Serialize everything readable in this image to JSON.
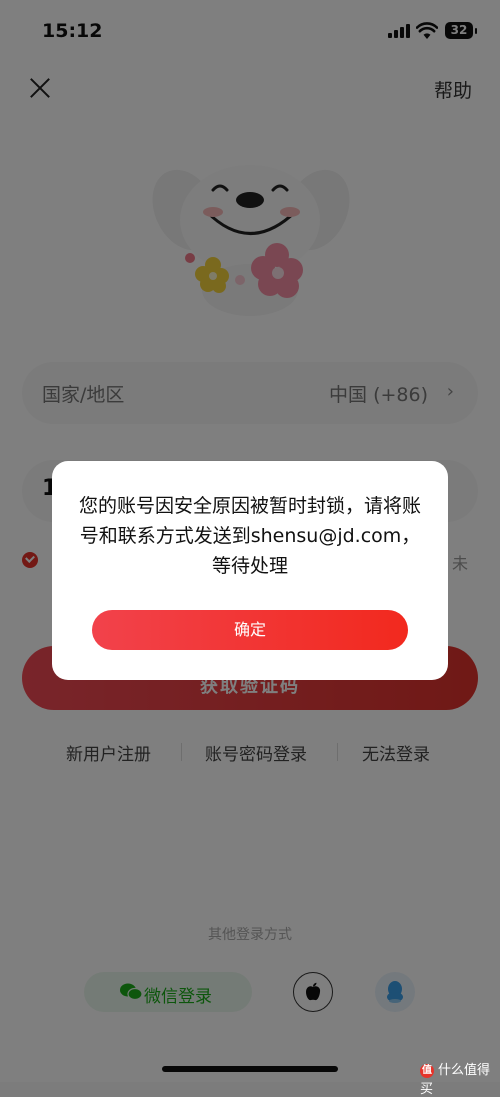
{
  "status_bar": {
    "time": "15:12",
    "battery": "32"
  },
  "header": {
    "help_label": "帮助"
  },
  "form": {
    "country_label": "国家/地区",
    "country_value": "中国 (+86)",
    "country_chevron": "›",
    "phone_value": "1",
    "agreement_tail": "未",
    "get_code_label": "获取验证码"
  },
  "links": [
    {
      "label": "新用户注册"
    },
    {
      "label": "账号密码登录"
    },
    {
      "label": "无法登录"
    }
  ],
  "other_login": {
    "title": "其他登录方式",
    "wechat_label": "微信登录",
    "icons": [
      "wechat-icon",
      "apple-icon",
      "qq-icon"
    ]
  },
  "dialog": {
    "message": "您的账号因安全原因被暂时封锁，请将账号和联系方式发送到shensu@jd.com，等待处理",
    "confirm_label": "确定"
  },
  "watermark": {
    "text": "什么值得买",
    "logo_char": "值"
  },
  "colors": {
    "accent": "#e6332a",
    "wechat_green": "#1aad19",
    "overlay": "rgba(0,0,0,0.5)"
  }
}
